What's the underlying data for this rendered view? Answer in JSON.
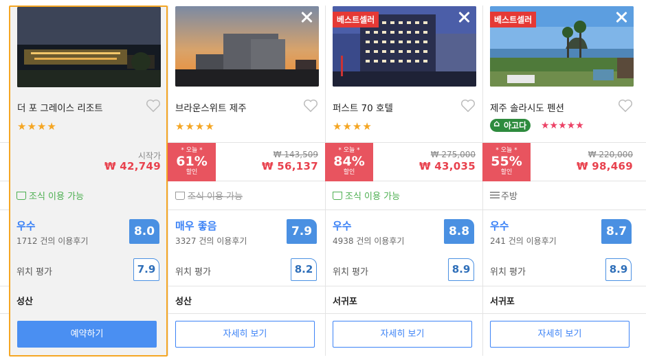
{
  "hotels": [
    {
      "name": "더 포 그레이스 리조트",
      "stars": "★★★★",
      "start_label": "시작가",
      "price": "₩ 42,749",
      "amenity": "조식 이용 가능",
      "rating_word": "우수",
      "reviews": "1712 건의 이용후기",
      "score": "8.0",
      "location_label": "위치 평가",
      "location_score": "7.9",
      "area": "성산",
      "button": "예약하기"
    },
    {
      "name": "브라운스위트 제주",
      "stars": "★★★★",
      "discount_today": "* 오늘 *",
      "discount_pct": "61%",
      "discount_sale": "할인",
      "original_price": "₩ 143,509",
      "price": "₩ 56,137",
      "amenity": "조식 이용 가능",
      "rating_word": "매우 좋음",
      "reviews": "3327 건의 이용후기",
      "score": "7.9",
      "location_label": "위치 평가",
      "location_score": "8.2",
      "area": "성산",
      "button": "자세히 보기"
    },
    {
      "name": "퍼스트 70 호텔",
      "badge": "베스트셀러",
      "stars": "★★★★",
      "discount_today": "* 오늘 *",
      "discount_pct": "84%",
      "discount_sale": "할인",
      "original_price": "₩ 275,000",
      "price": "₩ 43,035",
      "amenity": "조식 이용 가능",
      "rating_word": "우수",
      "reviews": "4938 건의 이용후기",
      "score": "8.8",
      "location_label": "위치 평가",
      "location_score": "8.9",
      "area": "서귀포",
      "button": "자세히 보기"
    },
    {
      "name": "제주 솔라시도 펜션",
      "badge": "베스트셀러",
      "agoda_badge": "아고다",
      "stars": "★★★★★",
      "discount_today": "* 오늘 *",
      "discount_pct": "55%",
      "discount_sale": "할인",
      "original_price": "₩ 220,000",
      "price": "₩ 98,469",
      "amenity": "주방",
      "rating_word": "우수",
      "reviews": "241 건의 이용후기",
      "score": "8.7",
      "location_label": "위치 평가",
      "location_score": "8.9",
      "area": "서귀포",
      "button": "자세히 보기"
    }
  ],
  "colors": {
    "accent": "#4a8ff2",
    "selected_border": "#f5a623",
    "price_red": "#e8424e",
    "discount_bg": "#e8545f",
    "amenity_green": "#4caf50"
  }
}
